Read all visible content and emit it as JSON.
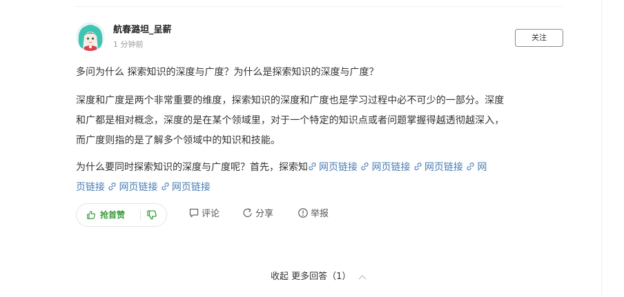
{
  "author": {
    "name": "航春潞坦_呈薪",
    "time": "1 分钟前",
    "avatar_icon": "anime-avatar-icon"
  },
  "follow_label": "关注",
  "question_line": "多问为什么 探索知识的深度与广度？为什么是探索知识的深度与广度？",
  "paragraph1": [
    "深度和广度是两个非常重要的维度，探索知识的深度和广度也是学习过程中必不可少的一部分。深度",
    "和广都是相对概念，深度的是在某个领域里，对于一个特定的知识点或者问题掌握得越透彻越深入，",
    "而广度则指的是了解多个领域中的知识和技能。"
  ],
  "paragraph2": {
    "prefix": "为什么要同时探索知识的深度与广度呢？首先，探索知",
    "links_line1": [
      "网页链接",
      "网页链接",
      "网页链接",
      "网"
    ],
    "line2_first": "页链接",
    "links_line2": [
      "网页链接",
      "网页链接"
    ]
  },
  "actions": {
    "like_label": "抢首赞",
    "comment_label": "评论",
    "share_label": "分享",
    "report_label": "举报"
  },
  "footer": {
    "collapse_label": "收起",
    "more_answers_label": "更多回答（1）"
  },
  "colors": {
    "link": "#4a7cb5",
    "like_green": "#3a9a3a",
    "text": "#333333"
  }
}
